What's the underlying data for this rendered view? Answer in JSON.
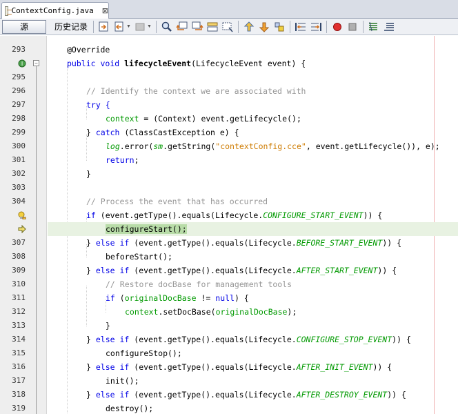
{
  "tab": {
    "title": "ContextConfig.java",
    "close": "⊠"
  },
  "toolbar": {
    "source_label": "源",
    "history_label": "历史记录"
  },
  "gutter_icons": {
    "override": "override-method-icon",
    "warning": "warning-bulb-icon",
    "current": "current-line-arrow-icon"
  },
  "lines": [
    {
      "num": "293",
      "text": "@Override"
    },
    {
      "num": "",
      "text": "public void lifecycleEvent(LifecycleEvent event) {"
    },
    {
      "num": "295",
      "text": ""
    },
    {
      "num": "296",
      "text": "// Identify the context we are associated with"
    },
    {
      "num": "297",
      "text": "try {"
    },
    {
      "num": "298",
      "text": "context = (Context) event.getLifecycle();"
    },
    {
      "num": "299",
      "text": "} catch (ClassCastException e) {"
    },
    {
      "num": "300",
      "text": "log.error(sm.getString(\"contextConfig.cce\", event.getLifecycle()), e);"
    },
    {
      "num": "301",
      "text": "return;"
    },
    {
      "num": "302",
      "text": "}"
    },
    {
      "num": "303",
      "text": ""
    },
    {
      "num": "304",
      "text": "// Process the event that has occurred"
    },
    {
      "num": "",
      "text": "if (event.getType().equals(Lifecycle.CONFIGURE_START_EVENT)) {"
    },
    {
      "num": "",
      "text": "configureStart();"
    },
    {
      "num": "307",
      "text": "} else if (event.getType().equals(Lifecycle.BEFORE_START_EVENT)) {"
    },
    {
      "num": "308",
      "text": "beforeStart();"
    },
    {
      "num": "309",
      "text": "} else if (event.getType().equals(Lifecycle.AFTER_START_EVENT)) {"
    },
    {
      "num": "310",
      "text": "// Restore docBase for management tools"
    },
    {
      "num": "311",
      "text": "if (originalDocBase != null) {"
    },
    {
      "num": "312",
      "text": "context.setDocBase(originalDocBase);"
    },
    {
      "num": "313",
      "text": "}"
    },
    {
      "num": "314",
      "text": "} else if (event.getType().equals(Lifecycle.CONFIGURE_STOP_EVENT)) {"
    },
    {
      "num": "315",
      "text": "configureStop();"
    },
    {
      "num": "316",
      "text": "} else if (event.getType().equals(Lifecycle.AFTER_INIT_EVENT)) {"
    },
    {
      "num": "317",
      "text": "init();"
    },
    {
      "num": "318",
      "text": "} else if (event.getType().equals(Lifecycle.AFTER_DESTROY_EVENT)) {"
    },
    {
      "num": "319",
      "text": "destroy();"
    }
  ],
  "tokens": {
    "l1": [
      "public",
      "void",
      "lifecycleEvent",
      "(LifecycleEvent event) {"
    ],
    "l5": [
      "context",
      " = (Context) event.getLifecycle();"
    ],
    "l6": [
      "} ",
      "catch",
      " (ClassCastException e) {"
    ],
    "l7": [
      "log",
      ".error(",
      "sm",
      ".getString(",
      "\"contextConfig.cce\"",
      ", event.getLifecycle()), e);"
    ],
    "l8": [
      "return",
      ";"
    ],
    "l12": [
      "if",
      " (event.getType().equals(Lifecycle.",
      "CONFIGURE_START_EVENT",
      ")) {"
    ],
    "l14": [
      "} ",
      "else",
      " ",
      "if",
      " (event.getType().equals(Lifecycle.",
      "BEFORE_START_EVENT",
      ")) {"
    ],
    "l16": [
      "AFTER_START_EVENT"
    ],
    "l18": [
      "if",
      " (",
      "originalDocBase",
      " != ",
      "null",
      ") {"
    ],
    "l19": [
      "context",
      ".setDocBase(",
      "originalDocBase",
      ");"
    ],
    "l21": [
      "CONFIGURE_STOP_EVENT"
    ],
    "l23": [
      "AFTER_INIT_EVENT"
    ],
    "l25": [
      "AFTER_DESTROY_EVENT"
    ]
  }
}
